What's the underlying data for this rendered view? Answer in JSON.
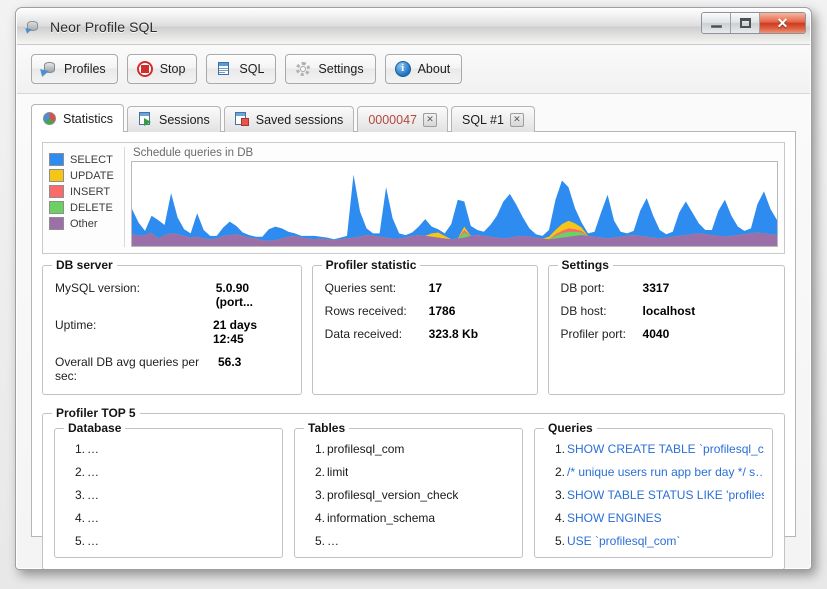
{
  "window": {
    "title": "Neor Profile SQL",
    "app_icon": "database-arrow-icon",
    "controls": {
      "minimize": "−",
      "maximize": "❐",
      "close": "✕"
    }
  },
  "toolbar": {
    "buttons": [
      {
        "label": "Profiles",
        "icon": "database-profiles-icon"
      },
      {
        "label": "Stop",
        "icon": "stop-record-icon"
      },
      {
        "label": "SQL",
        "icon": "sql-document-icon"
      },
      {
        "label": "Settings",
        "icon": "gear-icon"
      },
      {
        "label": "About",
        "icon": "info-circle-icon"
      }
    ]
  },
  "tabs": [
    {
      "label": "Statistics",
      "icon": "pie-chart-icon",
      "active": true,
      "closable": false
    },
    {
      "label": "Sessions",
      "icon": "session-page-icon",
      "active": false,
      "closable": false
    },
    {
      "label": "Saved sessions",
      "icon": "saved-session-icon",
      "active": false,
      "closable": false
    },
    {
      "label": "0000047",
      "icon": "",
      "active": false,
      "closable": true,
      "session": true
    },
    {
      "label": "SQL #1",
      "icon": "",
      "active": false,
      "closable": true
    }
  ],
  "chart_data": {
    "type": "area",
    "title": "Schedule queries in DB",
    "stacked": true,
    "xlabel": "",
    "ylabel": "",
    "grid": false,
    "legend_position": "left",
    "ylim": [
      0,
      100
    ],
    "series": [
      {
        "name": "Other",
        "color": "#9b6fa8",
        "values": [
          14,
          12,
          13,
          16,
          9,
          13,
          15,
          14,
          12,
          10,
          11,
          9,
          8,
          9,
          12,
          13,
          14,
          12,
          10,
          9,
          7,
          6,
          7,
          9,
          11,
          12,
          10,
          9,
          8,
          9,
          8,
          7,
          8,
          9,
          10,
          11,
          13,
          12,
          11,
          10,
          9,
          9,
          10,
          12,
          13,
          12,
          11,
          10,
          9,
          8,
          9,
          10,
          12,
          13,
          12,
          11,
          10,
          9,
          10,
          11,
          12,
          11,
          10,
          9,
          8,
          9,
          10,
          11,
          12,
          13,
          12,
          11,
          10,
          9,
          10,
          11,
          12,
          13,
          12,
          11,
          10,
          9,
          10,
          11,
          12,
          13,
          14,
          15,
          14,
          13,
          12,
          11,
          12,
          13,
          14,
          15,
          16,
          15,
          14,
          13
        ]
      },
      {
        "name": "DELETE",
        "color": "#6cd162",
        "values": [
          0,
          0,
          0,
          0,
          0,
          0,
          0,
          0,
          0,
          0,
          0,
          0,
          0,
          0,
          0,
          0,
          0,
          0,
          0,
          0,
          0,
          0,
          0,
          0,
          0,
          0,
          0,
          0,
          0,
          0,
          0,
          0,
          0,
          0,
          0,
          0,
          0,
          0,
          0,
          0,
          0,
          0,
          0,
          0,
          0,
          0,
          0,
          0,
          0,
          0,
          0,
          6,
          0,
          0,
          0,
          0,
          0,
          0,
          0,
          0,
          0,
          0,
          0,
          0,
          0,
          3,
          5,
          6,
          5,
          3,
          0,
          0,
          0,
          0,
          0,
          0,
          0,
          0,
          0,
          0,
          0,
          0,
          0,
          0,
          0,
          0,
          0,
          0,
          0,
          0,
          0,
          0,
          0,
          0,
          0,
          0,
          0,
          0,
          0,
          0
        ]
      },
      {
        "name": "INSERT",
        "color": "#f96a6a",
        "values": [
          0,
          0,
          0,
          0,
          0,
          0,
          0,
          0,
          0,
          0,
          0,
          0,
          0,
          0,
          0,
          0,
          0,
          0,
          0,
          0,
          0,
          0,
          0,
          0,
          0,
          0,
          0,
          0,
          0,
          0,
          0,
          0,
          0,
          0,
          0,
          0,
          0,
          0,
          0,
          0,
          0,
          0,
          0,
          0,
          0,
          0,
          0,
          0,
          0,
          0,
          0,
          3,
          0,
          0,
          0,
          0,
          0,
          0,
          0,
          0,
          0,
          0,
          0,
          0,
          0,
          2,
          3,
          4,
          3,
          2,
          0,
          0,
          0,
          0,
          0,
          0,
          0,
          0,
          0,
          0,
          0,
          0,
          0,
          0,
          0,
          0,
          0,
          0,
          0,
          0,
          0,
          0,
          0,
          0,
          0,
          0,
          0,
          0,
          0,
          0
        ]
      },
      {
        "name": "UPDATE",
        "color": "#f5c518",
        "values": [
          0,
          0,
          0,
          0,
          0,
          0,
          0,
          0,
          0,
          0,
          0,
          0,
          0,
          0,
          0,
          0,
          0,
          0,
          0,
          0,
          0,
          0,
          0,
          0,
          0,
          0,
          0,
          0,
          0,
          0,
          0,
          0,
          0,
          0,
          0,
          0,
          0,
          0,
          0,
          0,
          0,
          0,
          0,
          0,
          0,
          0,
          4,
          6,
          3,
          0,
          0,
          4,
          0,
          0,
          0,
          0,
          0,
          0,
          0,
          0,
          0,
          0,
          0,
          0,
          3,
          5,
          8,
          9,
          7,
          4,
          0,
          0,
          0,
          0,
          0,
          0,
          0,
          0,
          0,
          0,
          0,
          0,
          0,
          0,
          0,
          0,
          0,
          0,
          0,
          0,
          0,
          0,
          0,
          0,
          0,
          0,
          0,
          0,
          0,
          0
        ]
      },
      {
        "name": "SELECT",
        "color": "#2e8bf0",
        "values": [
          30,
          16,
          5,
          20,
          22,
          12,
          48,
          20,
          8,
          5,
          28,
          10,
          4,
          3,
          10,
          16,
          10,
          4,
          3,
          2,
          4,
          14,
          16,
          12,
          6,
          3,
          2,
          3,
          4,
          2,
          2,
          1,
          2,
          3,
          75,
          30,
          8,
          3,
          4,
          60,
          24,
          6,
          3,
          4,
          10,
          20,
          8,
          4,
          3,
          18,
          46,
          30,
          12,
          6,
          5,
          14,
          26,
          44,
          52,
          38,
          22,
          10,
          4,
          3,
          8,
          36,
          52,
          40,
          18,
          6,
          3,
          6,
          30,
          52,
          20,
          6,
          3,
          5,
          30,
          46,
          26,
          10,
          4,
          6,
          28,
          40,
          26,
          12,
          5,
          6,
          30,
          44,
          24,
          10,
          4,
          6,
          34,
          50,
          30,
          18
        ]
      }
    ],
    "legend": [
      {
        "label": "SELECT",
        "color": "#2e8bf0"
      },
      {
        "label": "UPDATE",
        "color": "#f5c518"
      },
      {
        "label": "INSERT",
        "color": "#f96a6a"
      },
      {
        "label": "DELETE",
        "color": "#6cd162"
      },
      {
        "label": "Other",
        "color": "#9b6fa8"
      }
    ]
  },
  "db_server": {
    "title": "DB server",
    "rows": [
      {
        "key": "MySQL version:",
        "value": "5.0.90 (port..."
      },
      {
        "key": "Uptime:",
        "value": "21 days 12:45"
      },
      {
        "key": "Overall DB avg queries per sec:",
        "value": "56.3"
      }
    ]
  },
  "profiler_statistic": {
    "title": "Profiler statistic",
    "rows": [
      {
        "key": "Queries sent:",
        "value": "17"
      },
      {
        "key": "Rows received:",
        "value": "1786"
      },
      {
        "key": "Data received:",
        "value": "323.8 Kb"
      }
    ]
  },
  "settings": {
    "title": "Settings",
    "rows": [
      {
        "key": "DB port:",
        "value": "3317"
      },
      {
        "key": "DB host:",
        "value": "localhost"
      },
      {
        "key": "Profiler port:",
        "value": "4040"
      }
    ]
  },
  "profiler_top5": {
    "title": "Profiler TOP 5",
    "database": {
      "title": "Database",
      "items": [
        {
          "num": "1.",
          "text": "…"
        },
        {
          "num": "2.",
          "text": "…"
        },
        {
          "num": "3.",
          "text": "…"
        },
        {
          "num": "4.",
          "text": "…"
        },
        {
          "num": "5.",
          "text": "…"
        }
      ]
    },
    "tables": {
      "title": "Tables",
      "items": [
        {
          "num": "1.",
          "text": "profilesql_com"
        },
        {
          "num": "2.",
          "text": "limit"
        },
        {
          "num": "3.",
          "text": "profilesql_version_check"
        },
        {
          "num": "4.",
          "text": "information_schema"
        },
        {
          "num": "5.",
          "text": "…"
        }
      ]
    },
    "queries": {
      "title": "Queries",
      "items": [
        {
          "num": "1.",
          "text": "SHOW CREATE TABLE `profilesql_co…"
        },
        {
          "num": "2.",
          "text": "/* unique users run app ber day */ s…"
        },
        {
          "num": "3.",
          "text": "SHOW TABLE STATUS LIKE 'profilesql…"
        },
        {
          "num": "4.",
          "text": "SHOW ENGINES"
        },
        {
          "num": "5.",
          "text": "USE `profilesql_com`"
        }
      ]
    }
  }
}
